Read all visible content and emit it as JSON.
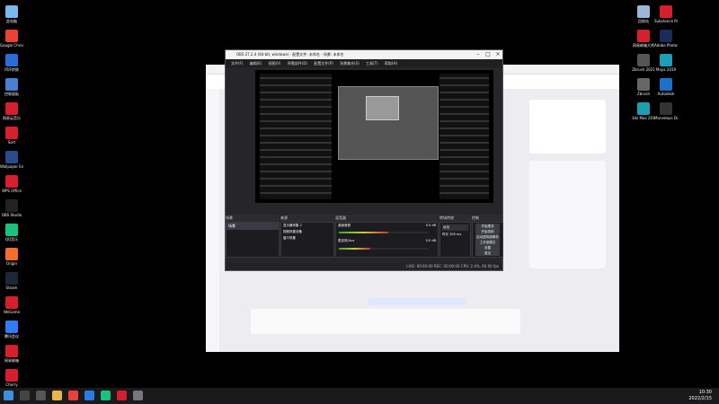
{
  "colors": {
    "desktop": "#000000",
    "obs_bg": "#262629",
    "accent_red": "#d61f2c",
    "browser_accent": "#e23a4a"
  },
  "desktop_icons_left": [
    {
      "label": "此电脑",
      "color": "#7ab7ea",
      "icon": "computer-icon"
    },
    {
      "label": "Google Chrome",
      "color": "#e94235",
      "icon": "chrome-icon"
    },
    {
      "label": "PDF转换",
      "color": "#2a6dd8",
      "icon": "pdf-icon"
    },
    {
      "label": "控制面板",
      "color": "#4a7fd0",
      "icon": "control-panel-icon"
    },
    {
      "label": "网易云音乐",
      "color": "#d61f2c",
      "icon": "music-icon"
    },
    {
      "label": "Sort",
      "color": "#d61f2c",
      "icon": "app-icon"
    },
    {
      "label": "Wallpaper Engine",
      "color": "#2c4a8a",
      "icon": "wallpaper-icon"
    },
    {
      "label": "WPS Office",
      "color": "#d61f2c",
      "icon": "wps-icon"
    },
    {
      "label": "OBS Studio",
      "color": "#222222",
      "icon": "obs-icon"
    },
    {
      "label": "QQ音乐",
      "color": "#19c37d",
      "icon": "qq-music-icon"
    },
    {
      "label": "Origin",
      "color": "#f56c2d",
      "icon": "origin-icon"
    },
    {
      "label": "Steam",
      "color": "#1b2838",
      "icon": "steam-icon"
    },
    {
      "label": "WeGame",
      "color": "#d61f2c",
      "icon": "wegame-icon"
    },
    {
      "label": "腾讯会议",
      "color": "#2f7cf6",
      "icon": "meeting-icon"
    },
    {
      "label": "网易邮箱",
      "color": "#d61f2c",
      "icon": "mail-icon"
    },
    {
      "label": "Cherry",
      "color": "#d61f2c",
      "icon": "cherry-icon"
    }
  ],
  "desktop_icons_right": [
    {
      "label": "回收站",
      "icon": "recycle-bin-icon",
      "color": "#9bb6d6"
    },
    {
      "label": "网易邮箱大师",
      "icon": "mail-icon",
      "color": "#d61f2c"
    },
    {
      "label": "Zbrush 2021",
      "icon": "zbrush-icon",
      "color": "#555555"
    },
    {
      "label": "Zbrush",
      "icon": "zbrush-icon",
      "color": "#666666"
    },
    {
      "label": "3ds Max 2019",
      "icon": "max-icon",
      "color": "#1c9fb5"
    },
    {
      "label": "Substance Painter",
      "icon": "substance-icon",
      "color": "#d61f2c"
    },
    {
      "label": "Adobe Photoshop",
      "icon": "ps-icon",
      "color": "#1d2b5a"
    },
    {
      "label": "Maya 2019",
      "icon": "maya-icon",
      "color": "#1c9fb5"
    },
    {
      "label": "Autodesk",
      "icon": "autodesk-icon",
      "color": "#1d6fc7"
    },
    {
      "label": "Marvelous Designer",
      "icon": "marvelous-icon",
      "color": "#333333"
    }
  ],
  "obs": {
    "title": "OBS 27.2.4 (64-bit, windows) - 配置文件: 未命名 - 场景: 未命名",
    "menu": [
      "文件(F)",
      "编辑(E)",
      "视图(V)",
      "停靠部件(D)",
      "配置文件(P)",
      "场景集合(S)",
      "工具(T)",
      "帮助(H)"
    ],
    "scenes_header": "场景",
    "scene_item": "场景",
    "sources_header": "来源",
    "sources": [
      "显示器采集 2",
      "视频采集设备",
      "窗口采集"
    ],
    "mixer_header": "混音器",
    "mixer_tracks": [
      {
        "name": "桌面音频",
        "db": "0.0 dB",
        "level": 0.55
      },
      {
        "name": "麦克风/Aux",
        "db": "0.0 dB",
        "level": 0.35
      }
    ],
    "transition_header": "转场特效",
    "transition_select": "淡出",
    "duration_label": "时长",
    "duration_value": "300 ms",
    "controls_header": "控制",
    "controls": [
      "开始推流",
      "开始录制",
      "启动虚拟摄像机",
      "工作室模式",
      "设置",
      "退出"
    ],
    "status": "LIVE: 00:00:00   REC: 00:00:00   CPU: 2.4%, 60.00 fps"
  },
  "taskbar": {
    "time": "10:30",
    "date": "2022/2/15"
  }
}
